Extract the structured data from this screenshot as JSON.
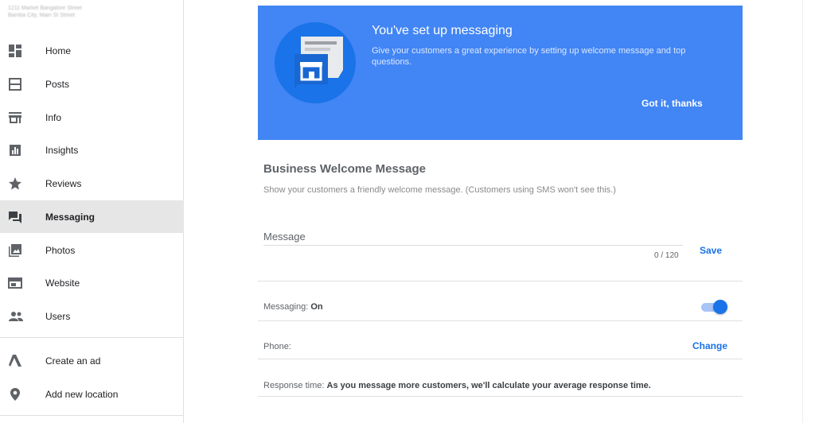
{
  "sidebar": {
    "business_name": "1211 Market Bangalore Street",
    "business_address": "Bamba City, Main St Street",
    "items": [
      {
        "label": "Home",
        "icon": "dashboard-icon"
      },
      {
        "label": "Posts",
        "icon": "posts-icon"
      },
      {
        "label": "Info",
        "icon": "store-icon"
      },
      {
        "label": "Insights",
        "icon": "insights-icon"
      },
      {
        "label": "Reviews",
        "icon": "star-icon"
      },
      {
        "label": "Messaging",
        "icon": "messaging-icon",
        "active": true
      },
      {
        "label": "Photos",
        "icon": "photos-icon"
      },
      {
        "label": "Website",
        "icon": "website-icon"
      },
      {
        "label": "Users",
        "icon": "users-icon"
      },
      {
        "label": "Create an ad",
        "icon": "ads-icon"
      },
      {
        "label": "Add new location",
        "icon": "location-pin-icon"
      }
    ]
  },
  "banner": {
    "title": "You've set up messaging",
    "subtitle": "Give your customers a great experience by setting up welcome message and top questions.",
    "action_label": "Got it, thanks",
    "background_color": "#4285f4"
  },
  "welcome": {
    "title": "Business Welcome Message",
    "description": "Show your customers a friendly welcome message. (Customers using SMS won't see this.)",
    "message_label": "Message",
    "message_value": "",
    "counter": "0 / 120",
    "save_label": "Save"
  },
  "settings": {
    "messaging_label": "Messaging:",
    "messaging_value": "On",
    "messaging_enabled": true,
    "phone_label": "Phone:",
    "change_label": "Change",
    "response_label": "Response time:",
    "response_value": "As you message more customers, we'll calculate your average response time."
  },
  "colors": {
    "accent": "#1a73e8",
    "active_nav_bg": "#e6e6e6"
  }
}
